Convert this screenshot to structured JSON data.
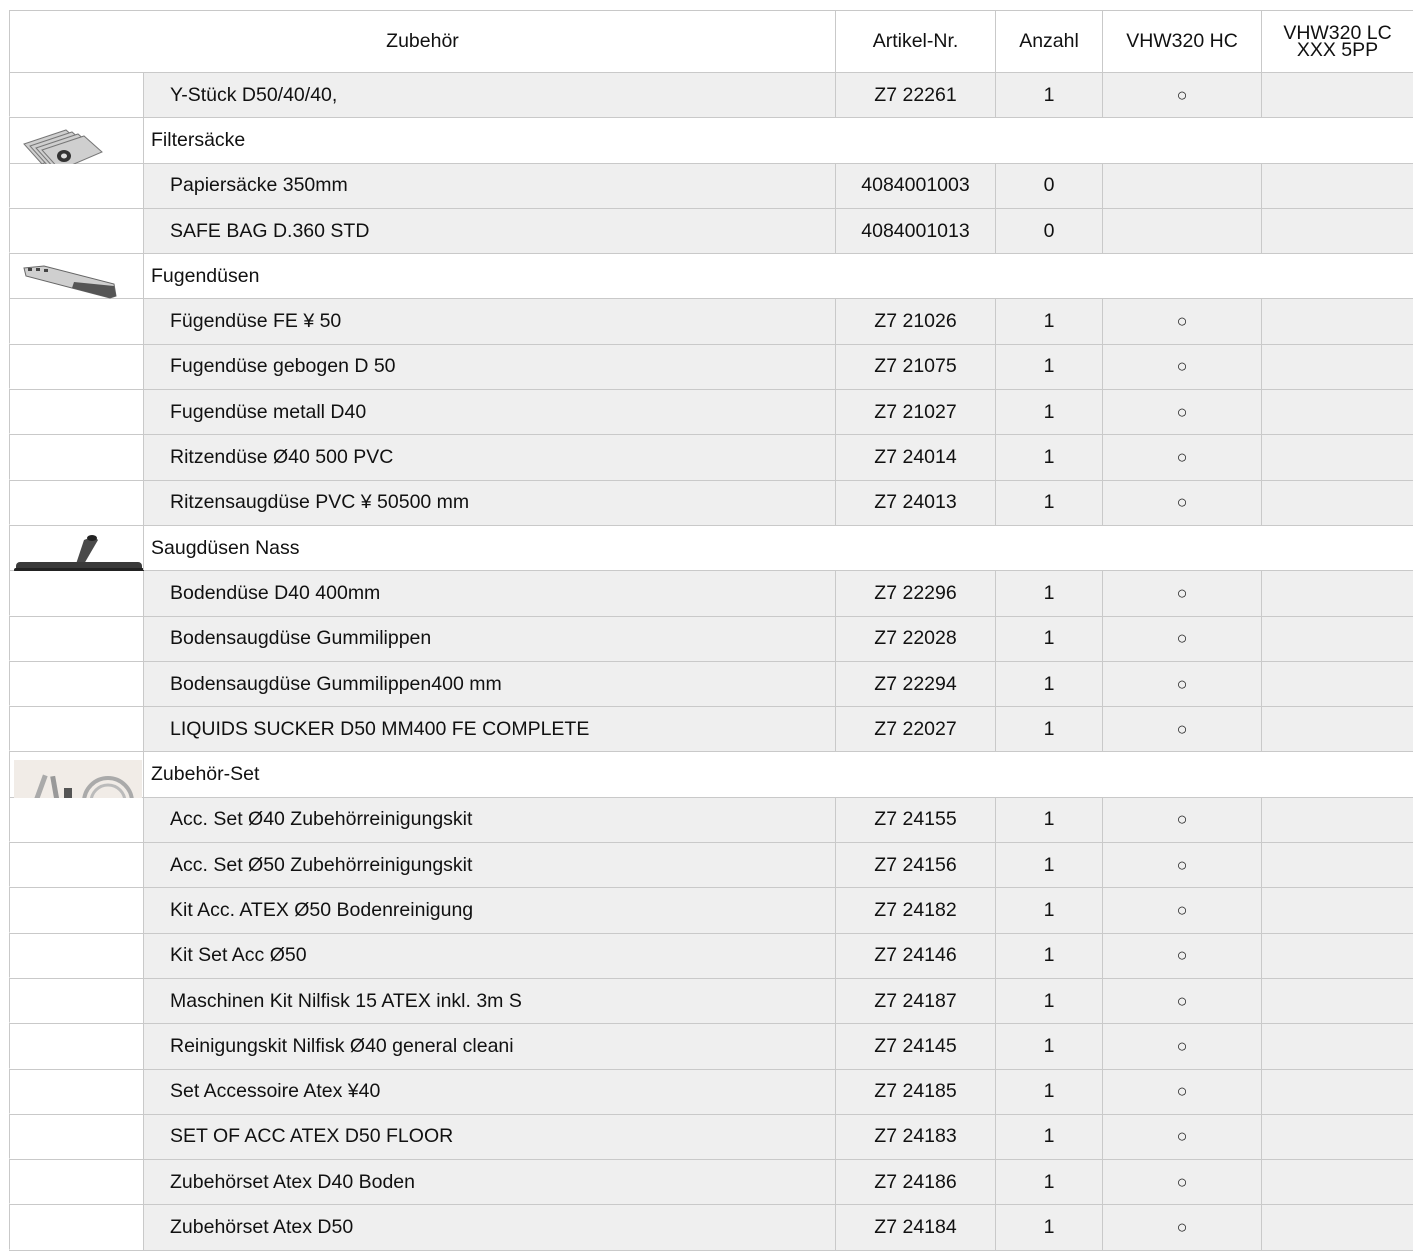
{
  "header": {
    "col_accessory": "Zubehör",
    "col_article": "Artikel-Nr.",
    "col_qty": "Anzahl",
    "col_hc": "VHW320 HC",
    "col_lc_line1": "VHW320 LC",
    "col_lc_line2": "XXX 5PP"
  },
  "rows": [
    {
      "type": "item",
      "name": "Y-Stück D50/40/40,",
      "article": "Z7 22261",
      "qty": "1",
      "hc": "○",
      "lc": ""
    },
    {
      "type": "group",
      "name": "Filtersäcke",
      "icon": "filter-bags-image"
    },
    {
      "type": "item",
      "name": "Papiersäcke 350mm",
      "article": "4084001003",
      "qty": "0",
      "hc": "",
      "lc": ""
    },
    {
      "type": "item",
      "name": "SAFE BAG D.360 STD",
      "article": "4084001013",
      "qty": "0",
      "hc": "",
      "lc": ""
    },
    {
      "type": "group",
      "name": "Fugendüsen",
      "icon": "crevice-nozzle-image"
    },
    {
      "type": "item",
      "name": "Fügendüse FE ¥ 50",
      "article": "Z7 21026",
      "qty": "1",
      "hc": "○",
      "lc": ""
    },
    {
      "type": "item",
      "name": "Fugendüse gebogen D 50",
      "article": "Z7 21075",
      "qty": "1",
      "hc": "○",
      "lc": ""
    },
    {
      "type": "item",
      "name": "Fugendüse metall D40",
      "article": "Z7 21027",
      "qty": "1",
      "hc": "○",
      "lc": ""
    },
    {
      "type": "item",
      "name": "Ritzendüse Ø40  500 PVC",
      "article": "Z7 24014",
      "qty": "1",
      "hc": "○",
      "lc": ""
    },
    {
      "type": "item",
      "name": "Ritzensaugdüse PVC ¥ 50500 mm",
      "article": "Z7 24013",
      "qty": "1",
      "hc": "○",
      "lc": ""
    },
    {
      "type": "group",
      "name": "Saugdüsen Nass",
      "icon": "floor-nozzle-image"
    },
    {
      "type": "item",
      "name": "Bodendüse D40 400mm",
      "article": "Z7 22296",
      "qty": "1",
      "hc": "○",
      "lc": ""
    },
    {
      "type": "item",
      "name": "Bodensaugdüse Gummilippen",
      "article": "Z7 22028",
      "qty": "1",
      "hc": "○",
      "lc": ""
    },
    {
      "type": "item",
      "name": "Bodensaugdüse Gummilippen400 mm",
      "article": "Z7 22294",
      "qty": "1",
      "hc": "○",
      "lc": ""
    },
    {
      "type": "item",
      "name": "LIQUIDS SUCKER D50 MM400 FE COMPLETE",
      "article": "Z7 22027",
      "qty": "1",
      "hc": "○",
      "lc": ""
    },
    {
      "type": "group",
      "name": "Zubehör-Set",
      "icon": "accessory-set-image"
    },
    {
      "type": "item",
      "name": "Acc. Set Ø40 Zubehörreinigungskit",
      "article": "Z7 24155",
      "qty": "1",
      "hc": "○",
      "lc": ""
    },
    {
      "type": "item",
      "name": "Acc. Set Ø50 Zubehörreinigungskit",
      "article": "Z7 24156",
      "qty": "1",
      "hc": "○",
      "lc": ""
    },
    {
      "type": "item",
      "name": "Kit Acc. ATEX Ø50 Bodenreinigung",
      "article": "Z7 24182",
      "qty": "1",
      "hc": "○",
      "lc": ""
    },
    {
      "type": "item",
      "name": "Kit Set Acc Ø50",
      "article": "Z7 24146",
      "qty": "1",
      "hc": "○",
      "lc": ""
    },
    {
      "type": "item",
      "name": "Maschinen Kit Nilfisk 15 ATEX inkl. 3m S",
      "article": "Z7 24187",
      "qty": "1",
      "hc": "○",
      "lc": ""
    },
    {
      "type": "item",
      "name": "Reinigungskit Nilfisk Ø40 general cleani",
      "article": "Z7 24145",
      "qty": "1",
      "hc": "○",
      "lc": ""
    },
    {
      "type": "item",
      "name": "Set Accessoire Atex ¥40",
      "article": "Z7 24185",
      "qty": "1",
      "hc": "○",
      "lc": ""
    },
    {
      "type": "item",
      "name": "SET OF ACC ATEX D50 FLOOR",
      "article": "Z7 24183",
      "qty": "1",
      "hc": "○",
      "lc": ""
    },
    {
      "type": "item",
      "name": "Zubehörset Atex D40 Boden",
      "article": "Z7 24186",
      "qty": "1",
      "hc": "○",
      "lc": ""
    },
    {
      "type": "item",
      "name": "Zubehörset Atex D50",
      "article": "Z7 24184",
      "qty": "1",
      "hc": "○",
      "lc": ""
    }
  ]
}
